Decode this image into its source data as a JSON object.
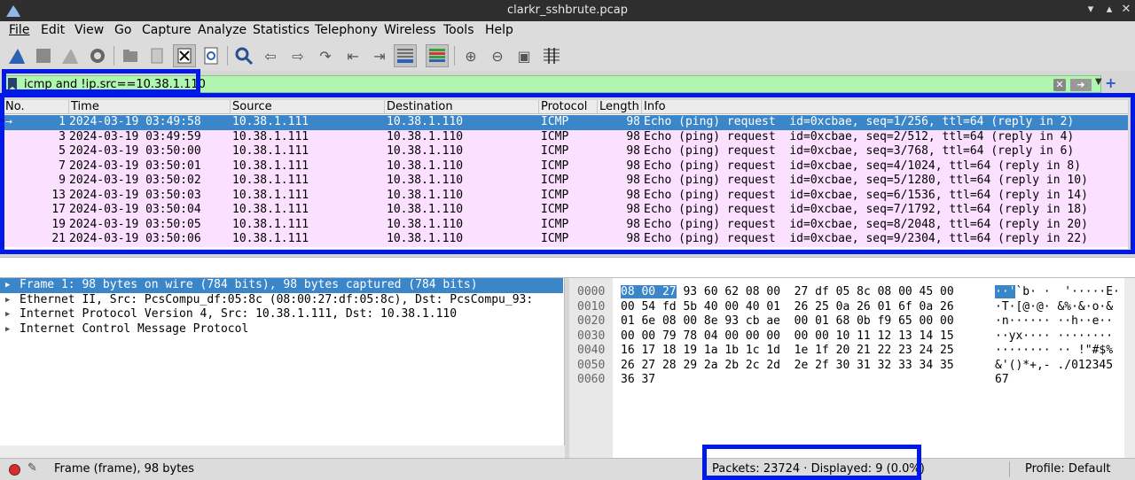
{
  "window": {
    "title": "clarkr_sshbrute.pcap"
  },
  "menu": [
    "File",
    "Edit",
    "View",
    "Go",
    "Capture",
    "Analyze",
    "Statistics",
    "Telephony",
    "Wireless",
    "Tools",
    "Help"
  ],
  "toolbar": {
    "icons": [
      "shark-fin-start-icon",
      "stop-capture-icon",
      "restart-capture-icon",
      "capture-options-icon",
      "open-file-icon",
      "save-file-icon",
      "close-file-icon",
      "reload-file-icon",
      "find-packet-icon",
      "go-back-icon",
      "go-forward-icon",
      "go-to-packet-icon",
      "first-packet-icon",
      "last-packet-icon",
      "autoscroll-icon",
      "colorize-icon",
      "zoom-in-icon",
      "zoom-out-icon",
      "normal-size-icon",
      "resize-columns-icon"
    ]
  },
  "filter": {
    "value": "icmp and !ip.src==10.38.1.110"
  },
  "packet_list": {
    "columns": [
      "No.",
      "Time",
      "Source",
      "Destination",
      "Protocol",
      "Length",
      "Info"
    ],
    "rows": [
      {
        "no": "1",
        "time": "2024-03-19 03:49:58",
        "src": "10.38.1.111",
        "dst": "10.38.1.110",
        "proto": "ICMP",
        "len": "98",
        "info": "Echo (ping) request  id=0xcbae, seq=1/256, ttl=64 (reply in 2)"
      },
      {
        "no": "3",
        "time": "2024-03-19 03:49:59",
        "src": "10.38.1.111",
        "dst": "10.38.1.110",
        "proto": "ICMP",
        "len": "98",
        "info": "Echo (ping) request  id=0xcbae, seq=2/512, ttl=64 (reply in 4)"
      },
      {
        "no": "5",
        "time": "2024-03-19 03:50:00",
        "src": "10.38.1.111",
        "dst": "10.38.1.110",
        "proto": "ICMP",
        "len": "98",
        "info": "Echo (ping) request  id=0xcbae, seq=3/768, ttl=64 (reply in 6)"
      },
      {
        "no": "7",
        "time": "2024-03-19 03:50:01",
        "src": "10.38.1.111",
        "dst": "10.38.1.110",
        "proto": "ICMP",
        "len": "98",
        "info": "Echo (ping) request  id=0xcbae, seq=4/1024, ttl=64 (reply in 8)"
      },
      {
        "no": "9",
        "time": "2024-03-19 03:50:02",
        "src": "10.38.1.111",
        "dst": "10.38.1.110",
        "proto": "ICMP",
        "len": "98",
        "info": "Echo (ping) request  id=0xcbae, seq=5/1280, ttl=64 (reply in 10)"
      },
      {
        "no": "13",
        "time": "2024-03-19 03:50:03",
        "src": "10.38.1.111",
        "dst": "10.38.1.110",
        "proto": "ICMP",
        "len": "98",
        "info": "Echo (ping) request  id=0xcbae, seq=6/1536, ttl=64 (reply in 14)"
      },
      {
        "no": "17",
        "time": "2024-03-19 03:50:04",
        "src": "10.38.1.111",
        "dst": "10.38.1.110",
        "proto": "ICMP",
        "len": "98",
        "info": "Echo (ping) request  id=0xcbae, seq=7/1792, ttl=64 (reply in 18)"
      },
      {
        "no": "19",
        "time": "2024-03-19 03:50:05",
        "src": "10.38.1.111",
        "dst": "10.38.1.110",
        "proto": "ICMP",
        "len": "98",
        "info": "Echo (ping) request  id=0xcbae, seq=8/2048, ttl=64 (reply in 20)"
      },
      {
        "no": "21",
        "time": "2024-03-19 03:50:06",
        "src": "10.38.1.111",
        "dst": "10.38.1.110",
        "proto": "ICMP",
        "len": "98",
        "info": "Echo (ping) request  id=0xcbae, seq=9/2304, ttl=64 (reply in 22)"
      }
    ],
    "selected_index": 0,
    "row_color": "#fce0ff",
    "selected_color": "#3a86c8"
  },
  "details": [
    "Frame 1: 98 bytes on wire (784 bits), 98 bytes captured (784 bits)",
    "Ethernet II, Src: PcsCompu_df:05:8c (08:00:27:df:05:8c), Dst: PcsCompu_93:",
    "Internet Protocol Version 4, Src: 10.38.1.111, Dst: 10.38.1.110",
    "Internet Control Message Protocol"
  ],
  "bytes": {
    "offsets": [
      "0000",
      "0010",
      "0020",
      "0030",
      "0040",
      "0050",
      "0060"
    ],
    "hex": [
      "93 60 62 08 00  27 df 05 8c 08 00 45 00",
      "00 54 fd 5b 40 00 40 01  26 25 0a 26 01 6f 0a 26",
      "01 6e 08 00 8e 93 cb ae  00 01 68 0b f9 65 00 00",
      "00 00 79 78 04 00 00 00  00 00 10 11 12 13 14 15",
      "16 17 18 19 1a 1b 1c 1d  1e 1f 20 21 22 23 24 25",
      "26 27 28 29 2a 2b 2c 2d  2e 2f 30 31 32 33 34 35",
      "36 37"
    ],
    "first_hex_selected": "08 00 27",
    "ascii": [
      "`b· ·  '·····E·",
      "·T·[@·@· &%·&·o·&",
      "·n······ ··h··e··",
      "··yx···· ········",
      "········ ·· !\"#$%",
      "&'()*+,- ./012345",
      "67"
    ],
    "first_ascii_selected": "··'"
  },
  "status": {
    "frame": "Frame (frame), 98 bytes",
    "packets": "Packets: 23724 · Displayed: 9 (0.0%)",
    "profile": "Profile: Default"
  },
  "highlight_color": "#0019e8"
}
